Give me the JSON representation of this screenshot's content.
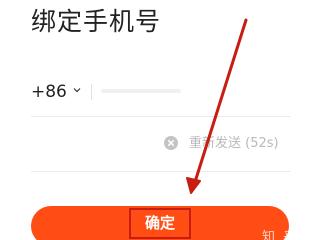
{
  "header": {
    "title": "绑定手机号"
  },
  "phone": {
    "country_code": "+86",
    "country_selector_icon": "chevron-down-icon"
  },
  "verification": {
    "clear_icon": "clear-circle-icon",
    "resend_label": "重新发送 (52s)"
  },
  "actions": {
    "confirm_label": "确定"
  },
  "overlay": {
    "arrow_icon": "annotation-arrow-icon",
    "watermark_text": "知 乎"
  },
  "colors": {
    "accent": "#ff4d14",
    "annotation": "#c81d12",
    "text_primary": "#222222",
    "text_muted": "#b9b9b9"
  }
}
